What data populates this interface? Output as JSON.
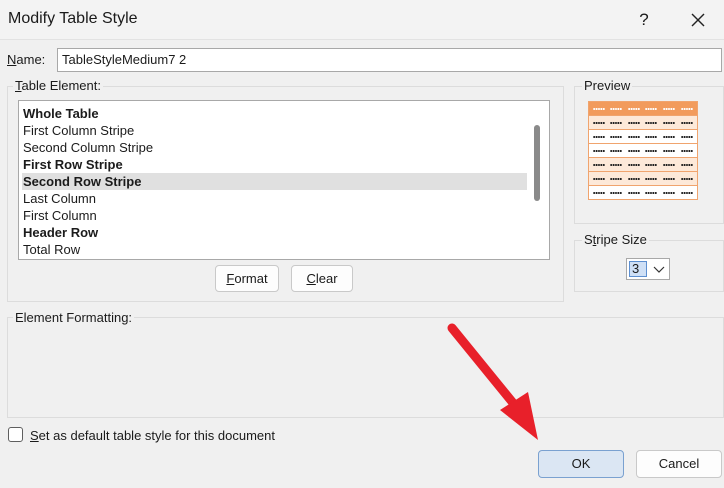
{
  "window": {
    "title": "Modify Table Style",
    "help_glyph": "?"
  },
  "name": {
    "label_accel": "N",
    "label_rest": "ame:",
    "value": "TableStyleMedium7 2"
  },
  "table_element": {
    "label_accel": "T",
    "label_rest": "able Element:",
    "items": [
      {
        "label": "Whole Table",
        "bold": true,
        "selected": false
      },
      {
        "label": "First Column Stripe",
        "bold": false,
        "selected": false
      },
      {
        "label": "Second Column Stripe",
        "bold": false,
        "selected": false
      },
      {
        "label": "First Row Stripe",
        "bold": true,
        "selected": false
      },
      {
        "label": "Second Row Stripe",
        "bold": true,
        "selected": true
      },
      {
        "label": "Last Column",
        "bold": false,
        "selected": false
      },
      {
        "label": "First Column",
        "bold": false,
        "selected": false
      },
      {
        "label": "Header Row",
        "bold": true,
        "selected": false
      },
      {
        "label": "Total Row",
        "bold": false,
        "selected": false
      }
    ]
  },
  "buttons": {
    "format_accel": "F",
    "format_rest": "ormat",
    "clear_accel": "C",
    "clear_rest": "lear",
    "ok": "OK",
    "cancel": "Cancel"
  },
  "preview": {
    "label": "Preview",
    "header_color": "#f29b5c",
    "border_color": "#f0a46e"
  },
  "stripe_size": {
    "label_pre": "S",
    "label_accel": "t",
    "label_rest": "ripe Size",
    "value": "3"
  },
  "element_formatting": {
    "label": "Element Formatting:"
  },
  "default_option": {
    "label_accel": "S",
    "label_rest": "et as default table style for this document",
    "checked": false
  },
  "annotation": {
    "arrow_color": "#e8202a"
  }
}
